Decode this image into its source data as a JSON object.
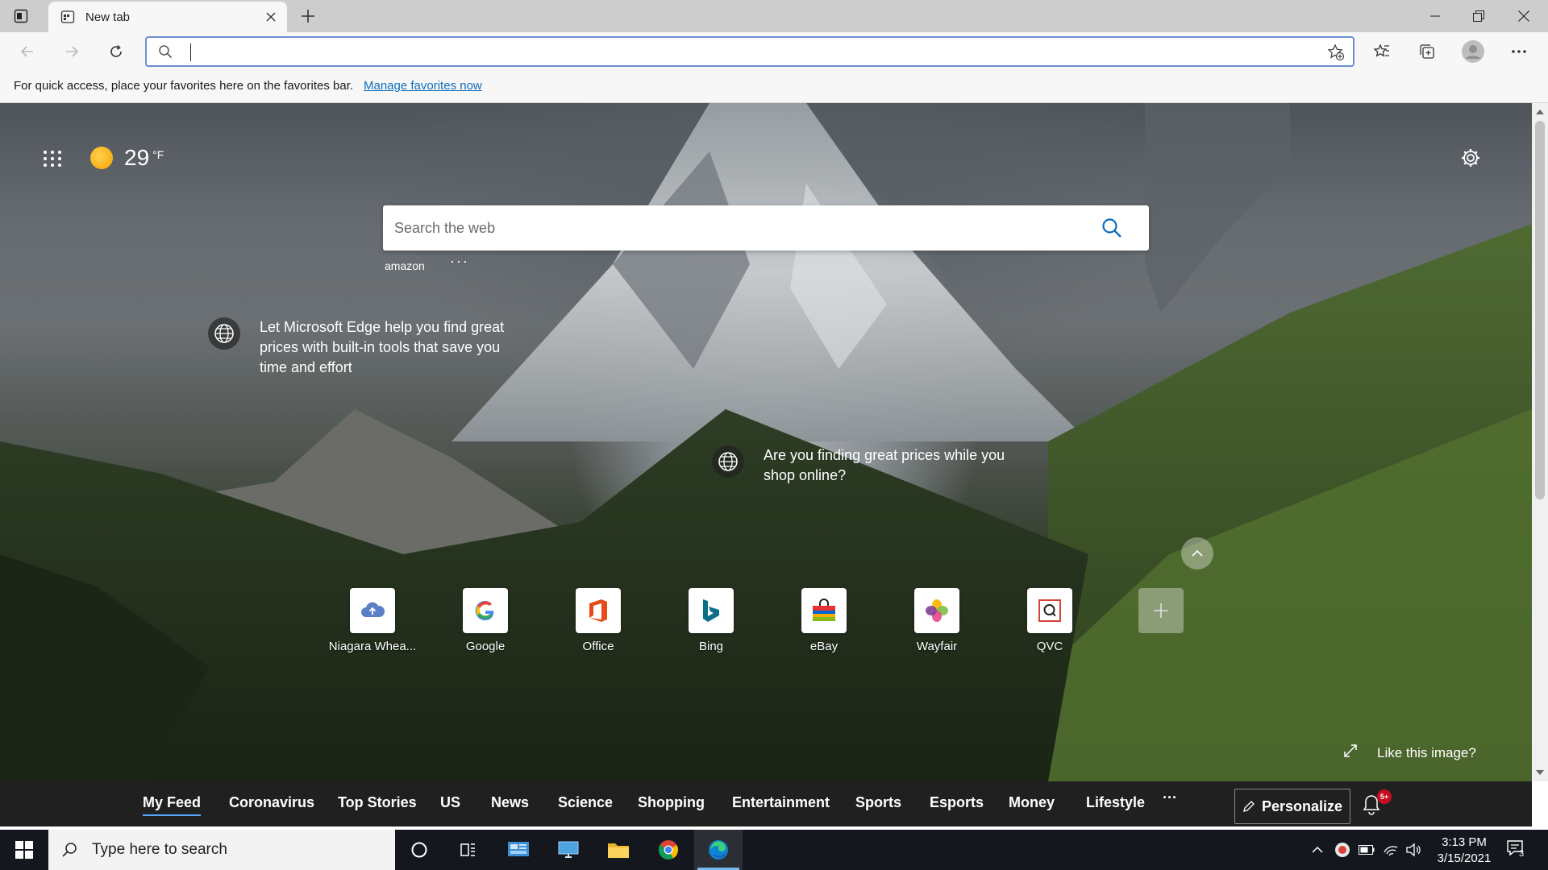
{
  "browser": {
    "tab": {
      "title": "New tab"
    },
    "address_bar": {
      "value": "",
      "placeholder": ""
    }
  },
  "favorites_bar": {
    "message": "For quick access, place your favorites here on the favorites bar.",
    "link": "Manage favorites now"
  },
  "ntp": {
    "weather": {
      "temperature": "29",
      "unit": "°F"
    },
    "search": {
      "placeholder": "Search the web"
    },
    "trending": {
      "label": "amazon",
      "more": "···"
    },
    "promo_1": "Let Microsoft Edge help you find great prices with built-in tools that save you time and effort",
    "promo_2": "Are you finding great prices while you shop online?",
    "quick_links": [
      {
        "name": "Niagara Whea...",
        "icon": "cloud-icon"
      },
      {
        "name": "Google",
        "icon": "google-icon"
      },
      {
        "name": "Office",
        "icon": "office-icon"
      },
      {
        "name": "Bing",
        "icon": "bing-icon"
      },
      {
        "name": "eBay",
        "icon": "ebay-icon"
      },
      {
        "name": "Wayfair",
        "icon": "wayfair-icon"
      },
      {
        "name": "QVC",
        "icon": "qvc-icon"
      }
    ],
    "like_image": "Like this image?"
  },
  "feed": {
    "tabs": [
      "My Feed",
      "Coronavirus",
      "Top Stories",
      "US",
      "News",
      "Science",
      "Shopping",
      "Entertainment",
      "Sports",
      "Esports",
      "Money",
      "Lifestyle"
    ],
    "more": "···",
    "personalize": "Personalize",
    "notifications_badge": "5+"
  },
  "taskbar": {
    "search_placeholder": "Type here to search",
    "time": "3:13 PM",
    "date": "3/15/2021",
    "notification_count": "3"
  },
  "colors": {
    "accent": "#0f6cbd",
    "feed_bar": "#202020",
    "taskbar": "#14181e"
  }
}
